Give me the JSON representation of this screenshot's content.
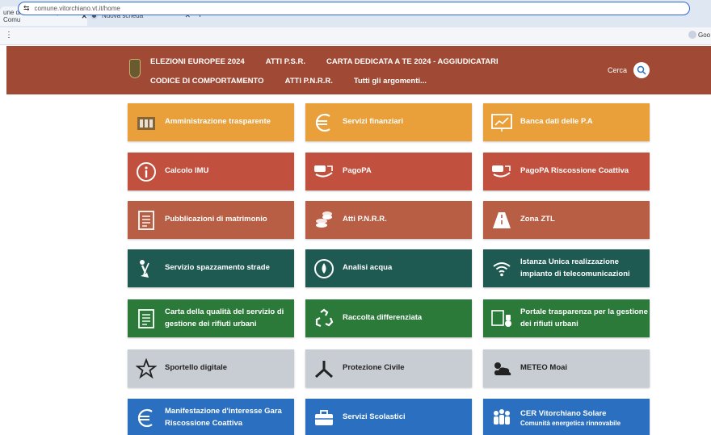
{
  "browser": {
    "tabs": [
      {
        "title": "une di Vitorchiano | Comu",
        "close": "✕"
      },
      {
        "title": "Nuova scheda",
        "close": "✕"
      }
    ],
    "new_tab": "+",
    "url": "comune.vitorchiano.vt.it/home",
    "profile_label": "Goo"
  },
  "header": {
    "nav_row1": [
      "ELEZIONI EUROPEE 2024",
      "ATTI P.S.R.",
      "CARTA DEDICATA A TE 2024 - AGGIUDICATARI"
    ],
    "nav_row2": [
      "CODICE DI COMPORTAMENTO",
      "ATTI P.N.R.R.",
      "Tutti gli argomenti..."
    ],
    "search_label": "Cerca",
    "background": "#a04a35"
  },
  "tiles": [
    {
      "label": "Amministrazione trasparente",
      "color": "#e9a03a",
      "icon": "building-icon"
    },
    {
      "label": "Servizi finanziari",
      "color": "#e9a03a",
      "icon": "euro-icon"
    },
    {
      "label": "Banca dati delle P.A",
      "color": "#e9a03a",
      "icon": "chart-board-icon"
    },
    {
      "label": "Calcolo IMU",
      "color": "#c2503e",
      "icon": "info-icon"
    },
    {
      "label": "PagoPA",
      "color": "#c2503e",
      "icon": "pagopa-icon"
    },
    {
      "label": "PagoPA Riscossione Coattiva",
      "color": "#c2503e",
      "icon": "pagopa-icon"
    },
    {
      "label": "Pubblicazioni di matrimonio",
      "color": "#b75e44",
      "icon": "document-icon"
    },
    {
      "label": "Atti P.N.R.R.",
      "color": "#b75e44",
      "icon": "coins-icon"
    },
    {
      "label": "Zona ZTL",
      "color": "#b75e44",
      "icon": "road-icon"
    },
    {
      "label": "Servizio spazzamento strade",
      "color": "#1f5a52",
      "icon": "sweeper-icon"
    },
    {
      "label": "Analisi acqua",
      "color": "#1f5a52",
      "icon": "water-drop-icon"
    },
    {
      "label": "Istanza Unica realizzazione impianto di telecomunicazioni",
      "color": "#1f5a52",
      "icon": "wifi-icon"
    },
    {
      "label": "Carta della qualità del servizio di gestione dei rifiuti urbani",
      "color": "#2c7a3a",
      "icon": "document-icon"
    },
    {
      "label": "Raccolta differenziata",
      "color": "#2c7a3a",
      "icon": "recycle-icon"
    },
    {
      "label": "Portale trasparenza per la gestione dei rifiuti urbani",
      "color": "#2c7a3a",
      "icon": "waste-bin-icon"
    },
    {
      "label": "Sportello digitale",
      "color": "#c7cdd3",
      "icon": "star-icon"
    },
    {
      "label": "Protezione Civile",
      "color": "#c7cdd3",
      "icon": "protezione-civile-icon"
    },
    {
      "label": "METEO Moai",
      "color": "#c7cdd3",
      "icon": "weather-icon"
    },
    {
      "label": "Manifestazione d'interesse Gara Riscossione Coattiva",
      "color": "#2b6fc0",
      "icon": "euro-icon"
    },
    {
      "label": "Servizi Scolastici",
      "color": "#2b6fc0",
      "icon": "briefcase-icon"
    },
    {
      "label": "CER Vitorchiano Solare",
      "sublabel": "Comunità energetica rinnovabile",
      "color": "#2b6fc0",
      "icon": "community-icon"
    }
  ]
}
